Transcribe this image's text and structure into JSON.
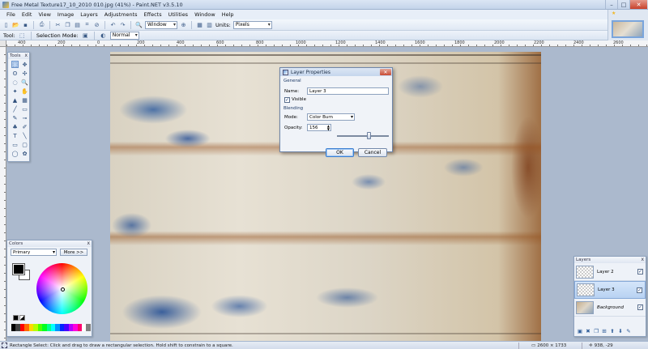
{
  "window": {
    "title": "Free Metal Texture17_10_2010 010.jpg (41%) - Paint.NET v3.5.10",
    "minimize": "–",
    "maximize": "□",
    "close": "✕"
  },
  "menu": [
    "File",
    "Edit",
    "View",
    "Image",
    "Layers",
    "Adjustments",
    "Effects",
    "Utilities",
    "Window",
    "Help"
  ],
  "toolbar": {
    "zoom_select": "Window",
    "units_label": "Units:",
    "units_value": "Pixels"
  },
  "toolbar2": {
    "tool_label": "Tool:",
    "selection_mode_label": "Selection Mode:",
    "blend_mode": "Normal"
  },
  "ruler": {
    "ticks": [
      "400",
      "200",
      "0",
      "200",
      "400",
      "600",
      "800",
      "1000",
      "1200",
      "1400",
      "1600",
      "1800",
      "2000",
      "2200",
      "2400",
      "2600"
    ]
  },
  "tools_panel": {
    "title": "Tools",
    "close": "x",
    "icons": [
      "rectangle-select-icon",
      "move-icon",
      "lasso-icon",
      "move-selection-icon",
      "ellipse-select-icon",
      "zoom-icon",
      "magic-wand-icon",
      "pan-icon",
      "paint-bucket-icon",
      "gradient-icon",
      "paintbrush-icon",
      "eraser-icon",
      "pencil-icon",
      "color-picker-icon",
      "clone-stamp-icon",
      "recolor-icon",
      "text-icon",
      "line-icon",
      "rectangle-icon",
      "rounded-rectangle-icon",
      "ellipse-icon",
      "freeform-shape-icon"
    ],
    "glyphs": [
      "⬚",
      "✥",
      "ʘ",
      "✣",
      "◌",
      "🔍",
      "✦",
      "✋",
      "▲",
      "▦",
      "╱",
      "▭",
      "✎",
      "⊸",
      "♣",
      "✐",
      "T",
      "╲",
      "▭",
      "▢",
      "◯",
      "✿"
    ]
  },
  "colors_panel": {
    "title": "Colors",
    "close": "x",
    "mode": "Primary",
    "more_button": "More >>",
    "primary_color": "#000000",
    "secondary_color": "#ffffff",
    "palette": [
      "#000000",
      "#404040",
      "#ff0000",
      "#ff6a00",
      "#ffd800",
      "#b6ff00",
      "#4cff00",
      "#00ff21",
      "#00ff90",
      "#00ffff",
      "#0094ff",
      "#0026ff",
      "#4800ff",
      "#b200ff",
      "#ff00dc",
      "#ff006e",
      "#ffffff",
      "#808080"
    ]
  },
  "layer_dialog": {
    "title": "Layer Properties",
    "close": "✕",
    "general_label": "General",
    "name_label": "Name:",
    "name_value": "Layer 3",
    "visible_label": "Visible",
    "visible_checked": "✓",
    "blending_label": "Blending",
    "mode_label": "Mode:",
    "mode_value": "Color Burn",
    "opacity_label": "Opacity:",
    "opacity_value": "156",
    "opacity_fraction": 0.61,
    "ok_button": "OK",
    "cancel_button": "Cancel"
  },
  "layers_panel": {
    "title": "Layers",
    "close": "x",
    "layers": [
      {
        "name": "Layer 2",
        "visible": "✓"
      },
      {
        "name": "Layer 3",
        "visible": "✓"
      },
      {
        "name": "Background",
        "visible": "✓"
      }
    ],
    "toolbar_icons": [
      "add-layer-icon",
      "delete-layer-icon",
      "duplicate-layer-icon",
      "merge-layer-icon",
      "move-layer-up-icon",
      "move-layer-down-icon",
      "layer-properties-icon"
    ],
    "toolbar_glyphs": [
      "▣",
      "✖",
      "❐",
      "⊞",
      "⬆",
      "⬇",
      "✎"
    ]
  },
  "status": {
    "hint": "Rectangle Select: Click and drag to draw a rectangular selection. Hold shift to constrain to a square.",
    "image_size": "2600 × 1733",
    "cursor": "938, -29"
  }
}
